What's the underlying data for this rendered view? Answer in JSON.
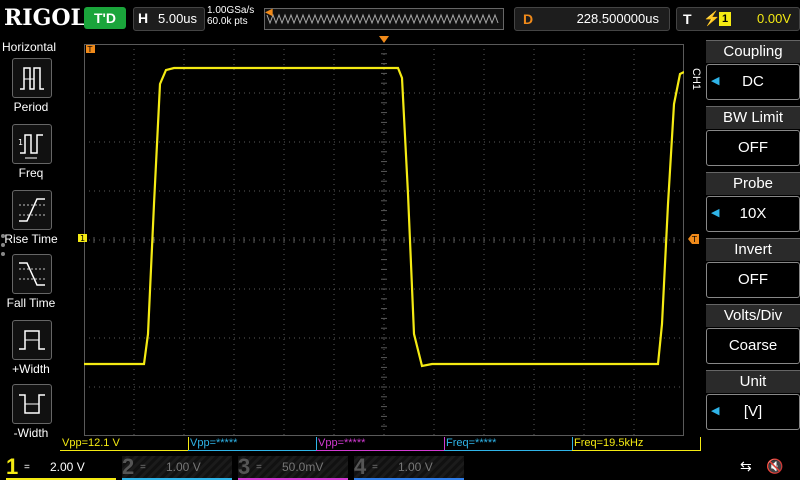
{
  "brand": "RIGOL",
  "topbar": {
    "trigger_status": "T'D",
    "horizontal_label": "H",
    "timebase": "5.00us",
    "sample_rate": "1.00GSa/s",
    "memory_depth": "60.0k pts",
    "delay_label": "D",
    "delay_value": "228.500000us",
    "trigger_label": "T",
    "trigger_channel": "1",
    "trigger_level": "0.00V"
  },
  "left_menu": {
    "title": "Horizontal",
    "items": [
      {
        "label": "Period",
        "icon": "period-icon"
      },
      {
        "label": "Freq",
        "icon": "freq-icon"
      },
      {
        "label": "Rise Time",
        "icon": "rise-time-icon"
      },
      {
        "label": "Fall Time",
        "icon": "fall-time-icon"
      },
      {
        "label": "+Width",
        "icon": "positive-width-icon"
      },
      {
        "label": "-Width",
        "icon": "negative-width-icon"
      }
    ]
  },
  "right_menu": {
    "channel_tab": "CH1",
    "items": [
      {
        "header": "Coupling",
        "value": "DC"
      },
      {
        "header": "BW Limit",
        "value": "OFF"
      },
      {
        "header": "Probe",
        "value": "10X"
      },
      {
        "header": "Invert",
        "value": "OFF"
      },
      {
        "header": "Volts/Div",
        "value": "Coarse"
      },
      {
        "header": "Unit",
        "value": "[V]"
      }
    ]
  },
  "measurements": [
    {
      "text": "Vpp=12.1 V",
      "color": "#f4ea13"
    },
    {
      "text": "Vpp=*****",
      "color": "#2fb4e8"
    },
    {
      "text": "Vpp=*****",
      "color": "#d23ad2"
    },
    {
      "text": "Freq=*****",
      "color": "#2fb4e8"
    },
    {
      "text": "Freq=19.5kHz",
      "color": "#f4ea13"
    }
  ],
  "channels": [
    {
      "num": "1",
      "coupling": "=",
      "scale": "2.00 V",
      "color": "#f4ea13",
      "active": true
    },
    {
      "num": "2",
      "coupling": "=",
      "scale": "1.00 V",
      "color": "#2fb4e8",
      "active": false
    },
    {
      "num": "3",
      "coupling": "=",
      "scale": "50.0mV",
      "color": "#d23ad2",
      "active": false
    },
    {
      "num": "4",
      "coupling": "=",
      "scale": "1.00 V",
      "color": "#2f7de8",
      "active": false
    }
  ],
  "colors": {
    "ch1": "#f4ea13",
    "grid": "#5a5a5a",
    "marker": "#f08a1a",
    "accent": "#2fb4e8"
  },
  "waveform": {
    "shape": "square",
    "period_divisions": 8.4
  }
}
